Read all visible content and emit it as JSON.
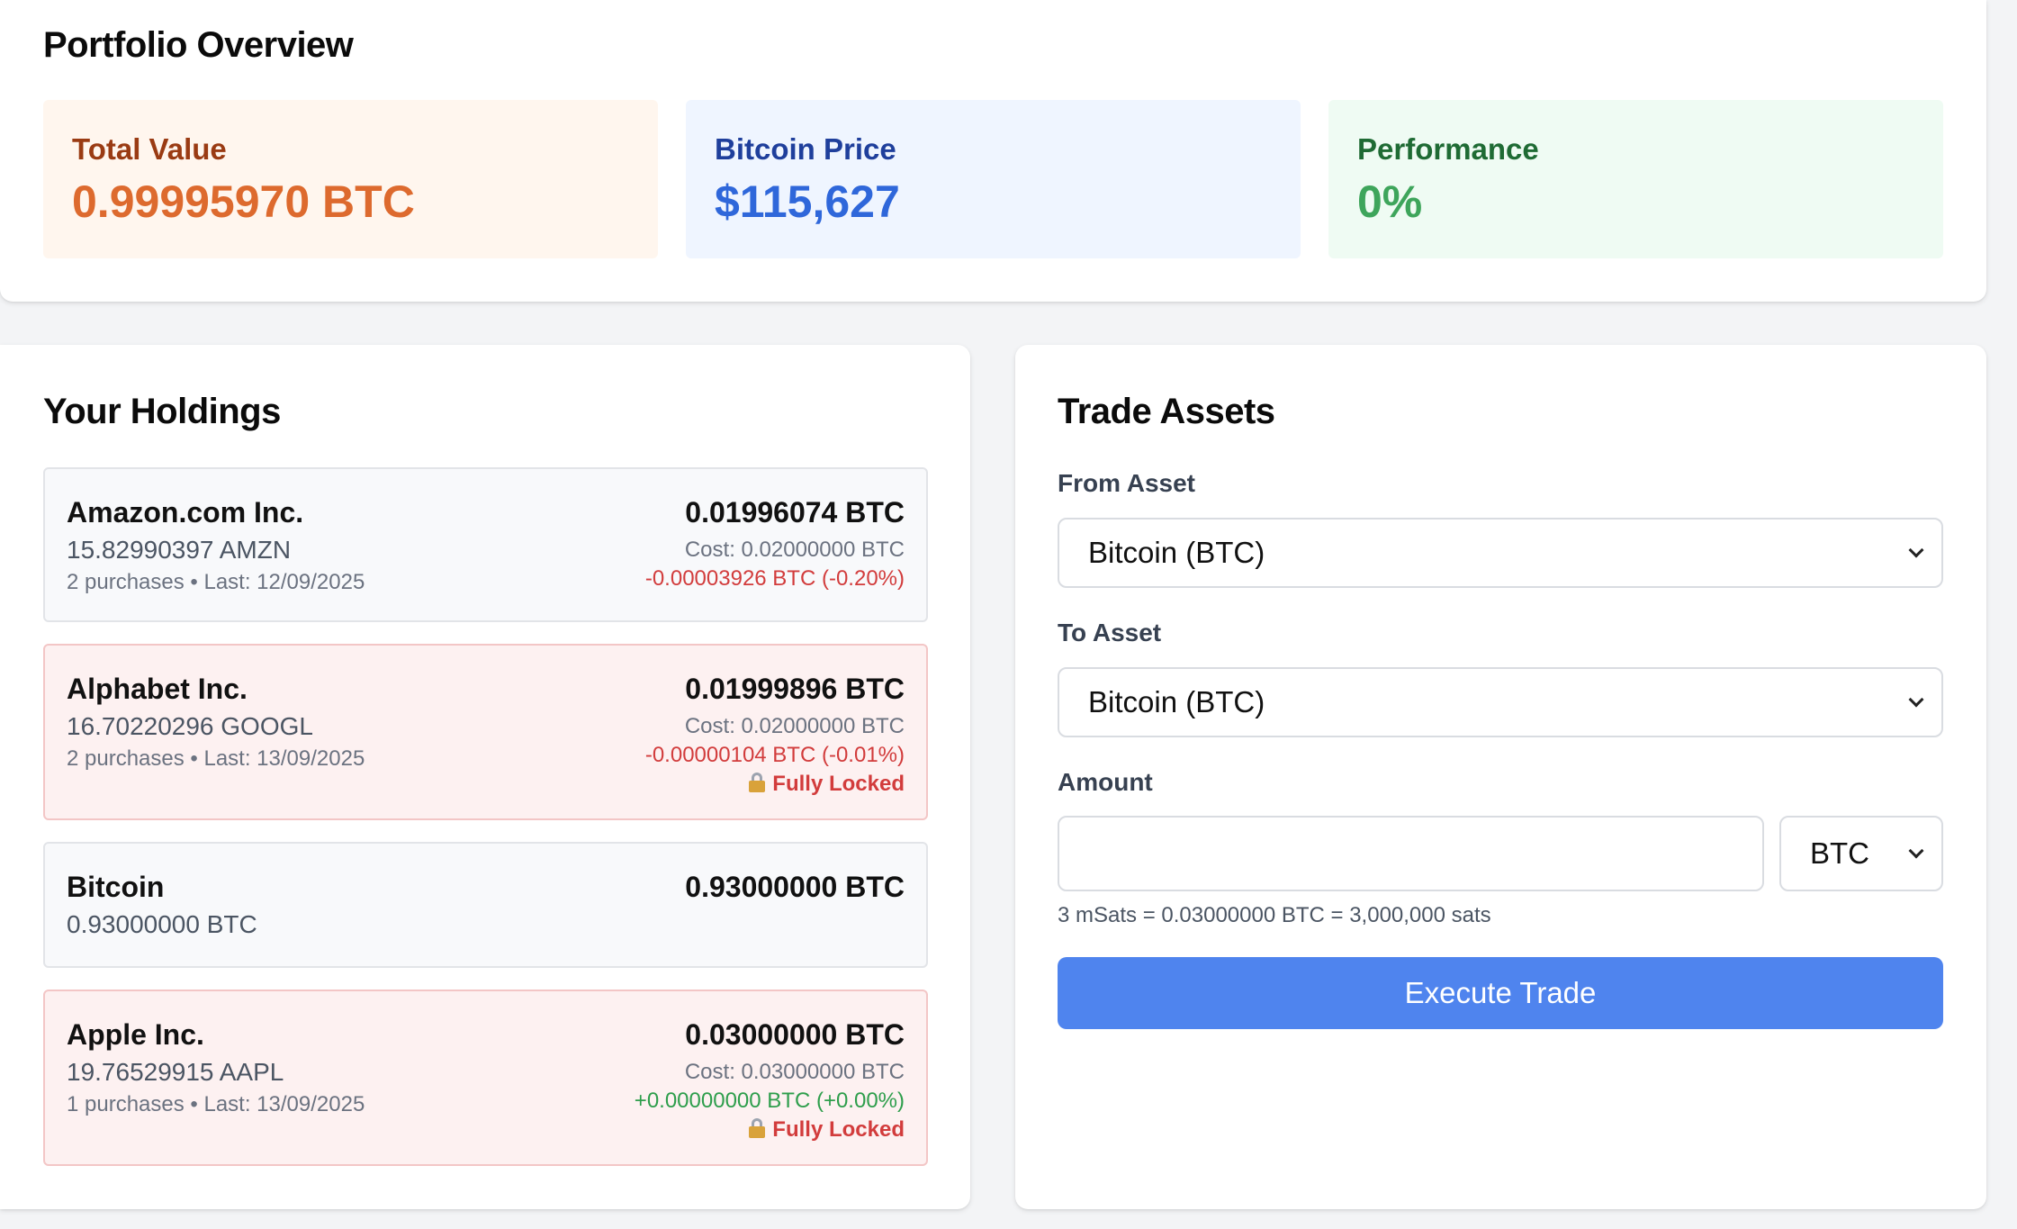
{
  "overview": {
    "title": "Portfolio Overview",
    "total_value": {
      "label": "Total Value",
      "value": "0.99995970 BTC"
    },
    "bitcoin_price": {
      "label": "Bitcoin Price",
      "value": "$115,627"
    },
    "performance": {
      "label": "Performance",
      "value": "0%"
    }
  },
  "holdings": {
    "title": "Your Holdings",
    "items": [
      {
        "name": "Amazon.com Inc.",
        "quantity": "15.82990397 AMZN",
        "meta": "2 purchases • Last: 12/09/2025",
        "value": "0.01996074 BTC",
        "cost": "Cost: 0.02000000 BTC",
        "pnl": "-0.00003926 BTC (-0.20%)",
        "pnl_direction": "negative",
        "locked": false
      },
      {
        "name": "Alphabet Inc.",
        "quantity": "16.70220296 GOOGL",
        "meta": "2 purchases • Last: 13/09/2025",
        "value": "0.01999896 BTC",
        "cost": "Cost: 0.02000000 BTC",
        "pnl": "-0.00000104 BTC (-0.01%)",
        "pnl_direction": "negative",
        "locked": true,
        "lock_label": "Fully Locked"
      },
      {
        "name": "Bitcoin",
        "quantity": "0.93000000 BTC",
        "value": "0.93000000 BTC",
        "locked": false
      },
      {
        "name": "Apple Inc.",
        "quantity": "19.76529915 AAPL",
        "meta": "1 purchases • Last: 13/09/2025",
        "value": "0.03000000 BTC",
        "cost": "Cost: 0.03000000 BTC",
        "pnl": "+0.00000000 BTC (+0.00%)",
        "pnl_direction": "positive",
        "locked": true,
        "lock_label": "Fully Locked"
      }
    ]
  },
  "trade": {
    "title": "Trade Assets",
    "from_label": "From Asset",
    "from_value": "Bitcoin (BTC)",
    "to_label": "To Asset",
    "to_value": "Bitcoin (BTC)",
    "amount_label": "Amount",
    "amount_value": "",
    "unit_value": "BTC",
    "conversion_hint": "3 mSats = 0.03000000 BTC = 3,000,000 sats",
    "execute_label": "Execute Trade"
  },
  "colors": {
    "accent_button": "#4f84ee",
    "total_value": "#dd6a2e",
    "bitcoin_price": "#2f67da",
    "performance": "#3ea55b",
    "loss": "#d23c3c",
    "gain": "#2e9e4c"
  },
  "icons": {
    "lock": "lock-icon",
    "select": "chevron-down-icon"
  }
}
